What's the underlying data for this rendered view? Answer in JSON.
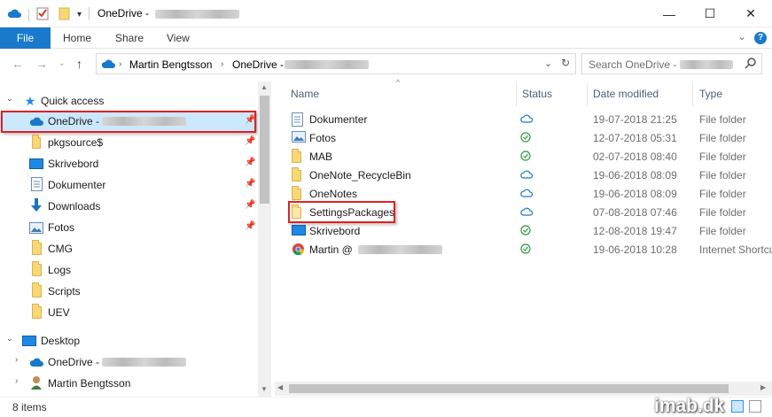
{
  "window": {
    "title": "OneDrive -",
    "controls": {
      "minimize": "—",
      "maximize": "☐",
      "close": "✕"
    }
  },
  "ribbon": {
    "tabs": [
      "File",
      "Home",
      "Share",
      "View"
    ],
    "help": "?",
    "expand": "⌄"
  },
  "address": {
    "crumbs": [
      "Martin Bengtsson",
      "OneDrive -"
    ],
    "search_placeholder": "Search OneDrive -"
  },
  "nav": {
    "items": [
      {
        "label": "Quick access",
        "icon": "star-icon"
      },
      {
        "label": "OneDrive -",
        "icon": "cloud-icon",
        "pinned": true,
        "selected": true
      },
      {
        "label": "pkgsource$",
        "icon": "share-folder-icon",
        "pinned": true
      },
      {
        "label": "Skrivebord",
        "icon": "desktop-icon",
        "pinned": true
      },
      {
        "label": "Dokumenter",
        "icon": "documents-icon",
        "pinned": true
      },
      {
        "label": "Downloads",
        "icon": "download-icon",
        "pinned": true
      },
      {
        "label": "Fotos",
        "icon": "pictures-icon",
        "pinned": true
      },
      {
        "label": "CMG",
        "icon": "folder-icon"
      },
      {
        "label": "Logs",
        "icon": "folder-icon"
      },
      {
        "label": "Scripts",
        "icon": "folder-icon"
      },
      {
        "label": "UEV",
        "icon": "folder-icon"
      },
      {
        "label": "Desktop",
        "icon": "desktop-icon"
      },
      {
        "label": "OneDrive -",
        "icon": "cloud-icon"
      },
      {
        "label": "Martin Bengtsson",
        "icon": "user-icon"
      }
    ]
  },
  "columns": [
    "Name",
    "Status",
    "Date modified",
    "Type"
  ],
  "files": [
    {
      "name": "Dokumenter",
      "status": "cloud",
      "date": "19-07-2018 21:25",
      "type": "File folder",
      "icon": "documents-icon"
    },
    {
      "name": "Fotos",
      "status": "synced",
      "date": "12-07-2018 05:31",
      "type": "File folder",
      "icon": "pictures-icon"
    },
    {
      "name": "MAB",
      "status": "synced",
      "date": "02-07-2018 08:40",
      "type": "File folder",
      "icon": "folder-icon"
    },
    {
      "name": "OneNote_RecycleBin",
      "status": "cloud",
      "date": "19-06-2018 08:09",
      "type": "File folder",
      "icon": "folder-icon"
    },
    {
      "name": "OneNotes",
      "status": "cloud",
      "date": "19-06-2018 08:09",
      "type": "File folder",
      "icon": "folder-icon"
    },
    {
      "name": "SettingsPackages",
      "status": "cloud",
      "date": "07-08-2018 07:46",
      "type": "File folder",
      "icon": "folder-icon"
    },
    {
      "name": "Skrivebord",
      "status": "synced",
      "date": "12-08-2018 19:47",
      "type": "File folder",
      "icon": "desktop-icon"
    },
    {
      "name": "Martin @",
      "status": "synced",
      "date": "19-06-2018 10:28",
      "type": "Internet Shortcut",
      "icon": "chrome-icon"
    }
  ],
  "status_bar": {
    "count": "8 items"
  },
  "watermark": "imab.dk",
  "colors": {
    "accent": "#1979ca",
    "selection": "#cce8ff",
    "highlight_box": "#e02020",
    "cloud": "#1979ca",
    "synced": "#2e9a3f"
  }
}
